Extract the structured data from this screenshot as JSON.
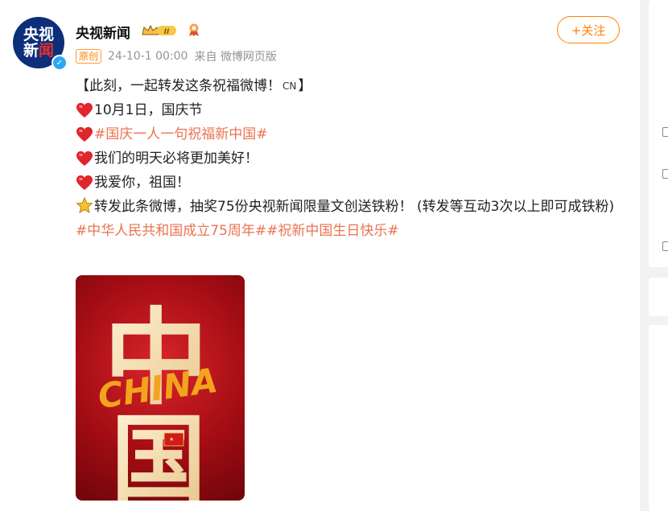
{
  "author": {
    "name": "央视新闻",
    "avatar_text_top": "央视",
    "avatar_text_bottom_1": "新",
    "avatar_text_bottom_2": "闻",
    "level": "II",
    "verified": "✓"
  },
  "meta": {
    "tag": "原创",
    "time": "24-10-1 00:00",
    "source": "来自 微博网页版"
  },
  "follow_label": "+关注",
  "post": {
    "line1_prefix": "【此刻，一起转发这条祝福微博！",
    "line1_cn": "CN",
    "line1_suffix": "】",
    "line2": "10月1日，国庆节",
    "line3_topic": "#国庆一人一句祝福新中国#",
    "line4": "我们的明天必将更加美好！",
    "line5": "我爱你，祖国！",
    "line6": "转发此条微博，抽奖75份央视新闻限量文创送铁粉！ (转发等互动3次以上即可成铁粉)",
    "line7_topic": "#中华人民共和国成立75周年##祝新中国生日快乐#"
  },
  "poster": {
    "char_top": "中",
    "char_bottom": "国",
    "english": "CHINA"
  },
  "colors": {
    "accent": "#ff8200",
    "topic": "#eb7350",
    "heart": "#e0262d",
    "poster_red": "#b8121a"
  }
}
